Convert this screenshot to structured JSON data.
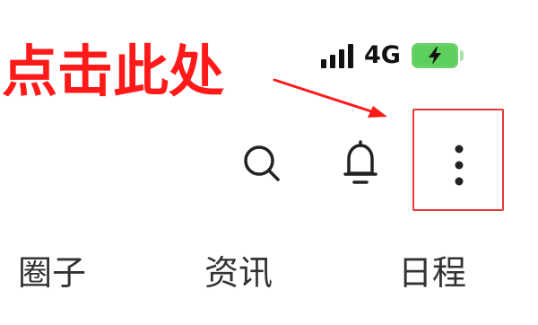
{
  "annotation": {
    "text": "点击此处",
    "color": "#ff1a1a"
  },
  "status_bar": {
    "signal_icon": "signal-bars-icon",
    "network": "4G",
    "battery_icon": "battery-charging-icon",
    "battery_color": "#5ccf5c"
  },
  "toolbar": {
    "search_icon": "search-icon",
    "bell_icon": "bell-icon",
    "more_icon": "more-vertical-icon",
    "highlight_color": "#e53935"
  },
  "tabs": [
    {
      "label": "圈子"
    },
    {
      "label": "资讯"
    },
    {
      "label": "日程"
    }
  ]
}
